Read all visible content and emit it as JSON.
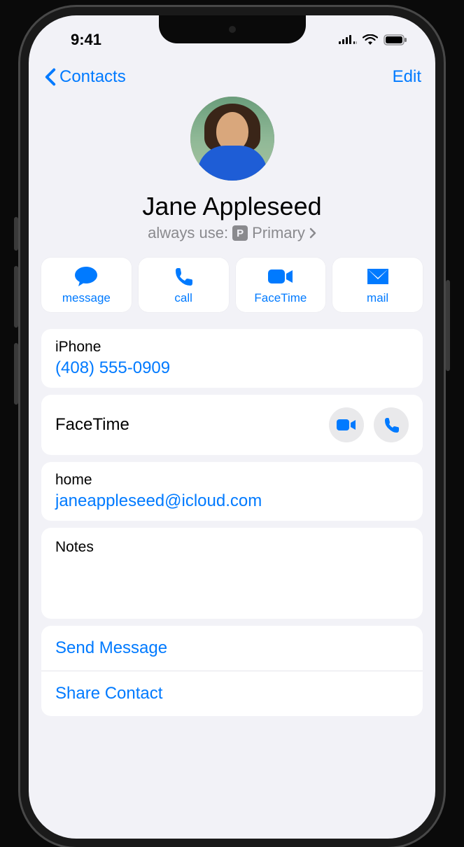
{
  "status": {
    "time": "9:41"
  },
  "nav": {
    "back_label": "Contacts",
    "edit_label": "Edit"
  },
  "contact": {
    "name": "Jane Appleseed",
    "always_use_label": "always use:",
    "always_use_badge": "P",
    "always_use_value": "Primary"
  },
  "actions": {
    "message": "message",
    "call": "call",
    "facetime": "FaceTime",
    "mail": "mail"
  },
  "phone": {
    "label": "iPhone",
    "value": "(408) 555-0909"
  },
  "facetime_section": {
    "label": "FaceTime"
  },
  "email": {
    "label": "home",
    "value": "janeappleseed@icloud.com"
  },
  "notes": {
    "label": "Notes"
  },
  "list_actions": {
    "send_message": "Send Message",
    "share_contact": "Share Contact"
  }
}
